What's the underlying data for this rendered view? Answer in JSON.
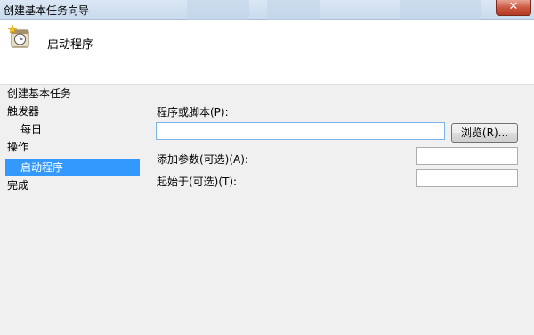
{
  "window": {
    "title": "创建基本任务向导",
    "close_glyph": "✕"
  },
  "header": {
    "title": "启动程序",
    "icon": "task-scheduler-clock-icon"
  },
  "sidebar": {
    "items": [
      {
        "label": "创建基本任务",
        "selected": false
      },
      {
        "label": "触发器",
        "selected": false
      },
      {
        "label": "每日",
        "selected": false
      },
      {
        "label": "操作",
        "selected": false
      },
      {
        "label": "启动程序",
        "selected": true
      },
      {
        "label": "完成",
        "selected": false
      }
    ]
  },
  "form": {
    "program_label": "程序或脚本(P):",
    "program_value": "",
    "browse_label": "浏览(R)...",
    "args_label": "添加参数(可选)(A):",
    "args_value": "",
    "start_in_label": "起始于(可选)(T):",
    "start_in_value": ""
  },
  "colors": {
    "selection": "#3399ff",
    "window_bg": "#f0f0f0",
    "header_bg": "#ffffff"
  }
}
